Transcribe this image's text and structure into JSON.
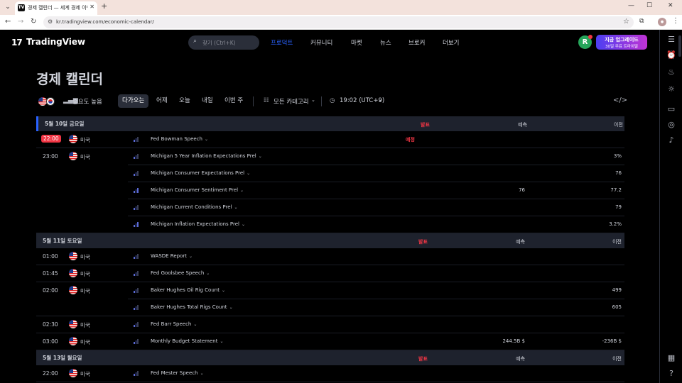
{
  "browser": {
    "tab_title": "경제 캘린더 — 세계 경제 이벤",
    "tab_favicon": "TV",
    "url": "kr.tradingview.com/economic-calendar/",
    "profile_initials": "메뉴"
  },
  "header": {
    "logo_text": "TradingView",
    "search_placeholder": "찾기 (Ctrl+K)",
    "nav": [
      {
        "label": "프로덕트",
        "active": true
      },
      {
        "label": "커뮤니티",
        "active": false
      },
      {
        "label": "마켓",
        "active": false
      },
      {
        "label": "뉴스",
        "active": false
      },
      {
        "label": "브로커",
        "active": false
      },
      {
        "label": "더보기",
        "active": false
      }
    ],
    "avatar_letter": "R",
    "upgrade_line1": "지금 업그레이드",
    "upgrade_line2": "30일 무료 트라이얼"
  },
  "page": {
    "title": "경제 캘린더"
  },
  "filters": {
    "importance": "중요도 높음",
    "periods": [
      "다가오는",
      "어제",
      "오늘",
      "내일",
      "이번 주"
    ],
    "active_period": "다가오는",
    "category": "모든 카테고리",
    "timezone": "19:02 (UTC+9)"
  },
  "columns": {
    "actual": "발표",
    "forecast": "예측",
    "previous": "이전"
  },
  "days": [
    {
      "label": "5월 10일 금요일",
      "rows": [
        {
          "time": "22:00",
          "highlight": true,
          "country": "미국",
          "event": "Fed Bowman Speech",
          "actual": "예정",
          "forecast": "",
          "previous": "",
          "importance": 2
        },
        {
          "time": "23:00",
          "country": "미국",
          "event": "Michigan 5 Year Inflation Expectations Prel",
          "actual": "",
          "forecast": "",
          "previous": "3%",
          "importance": 2
        },
        {
          "time": "",
          "country": "",
          "event": "Michigan Consumer Expectations Prel",
          "actual": "",
          "forecast": "",
          "previous": "76",
          "importance": 2
        },
        {
          "time": "",
          "country": "",
          "event": "Michigan Consumer Sentiment Prel",
          "actual": "",
          "forecast": "76",
          "previous": "77.2",
          "importance": 3
        },
        {
          "time": "",
          "country": "",
          "event": "Michigan Current Conditions Prel",
          "actual": "",
          "forecast": "",
          "previous": "79",
          "importance": 2
        },
        {
          "time": "",
          "country": "",
          "event": "Michigan Inflation Expectations Prel",
          "actual": "",
          "forecast": "",
          "previous": "3.2%",
          "importance": 3
        }
      ]
    },
    {
      "label": "5월 11일 토요일",
      "rows": [
        {
          "time": "01:00",
          "country": "미국",
          "event": "WASDE Report",
          "actual": "",
          "forecast": "",
          "previous": "",
          "importance": 2
        },
        {
          "time": "01:45",
          "country": "미국",
          "event": "Fed Goolsbee Speech",
          "actual": "",
          "forecast": "",
          "previous": "",
          "importance": 2
        },
        {
          "time": "02:00",
          "country": "미국",
          "event": "Baker Hughes Oil Rig Count",
          "actual": "",
          "forecast": "",
          "previous": "499",
          "importance": 2
        },
        {
          "time": "",
          "country": "",
          "event": "Baker Hughes Total Rigs Count",
          "actual": "",
          "forecast": "",
          "previous": "605",
          "importance": 2
        },
        {
          "time": "02:30",
          "country": "미국",
          "event": "Fed Barr Speech",
          "actual": "",
          "forecast": "",
          "previous": "",
          "importance": 2
        },
        {
          "time": "03:00",
          "country": "미국",
          "event": "Monthly Budget Statement",
          "actual": "",
          "forecast": "244.5B $",
          "previous": "-236B $",
          "importance": 2
        }
      ]
    },
    {
      "label": "5월 13일 월요일",
      "rows": [
        {
          "time": "22:00",
          "country": "미국",
          "event": "Fed Mester Speech",
          "actual": "",
          "forecast": "",
          "previous": "",
          "importance": 2
        }
      ]
    }
  ],
  "colors": {
    "accent": "#2962ff",
    "highlight_red": "#f23645",
    "row_header_bg": "#1e222d",
    "importance_bar": "#5b6bd6"
  },
  "icons": [
    "search-icon",
    "chevron-down-icon",
    "importance-icon",
    "category-list-icon",
    "clock-icon",
    "embed-code-icon",
    "watchlist-icon",
    "alarm-icon",
    "hotlist-icon",
    "ideas-icon",
    "chat-icon",
    "bulb-icon",
    "bell-icon",
    "calendar-icon",
    "help-icon"
  ]
}
